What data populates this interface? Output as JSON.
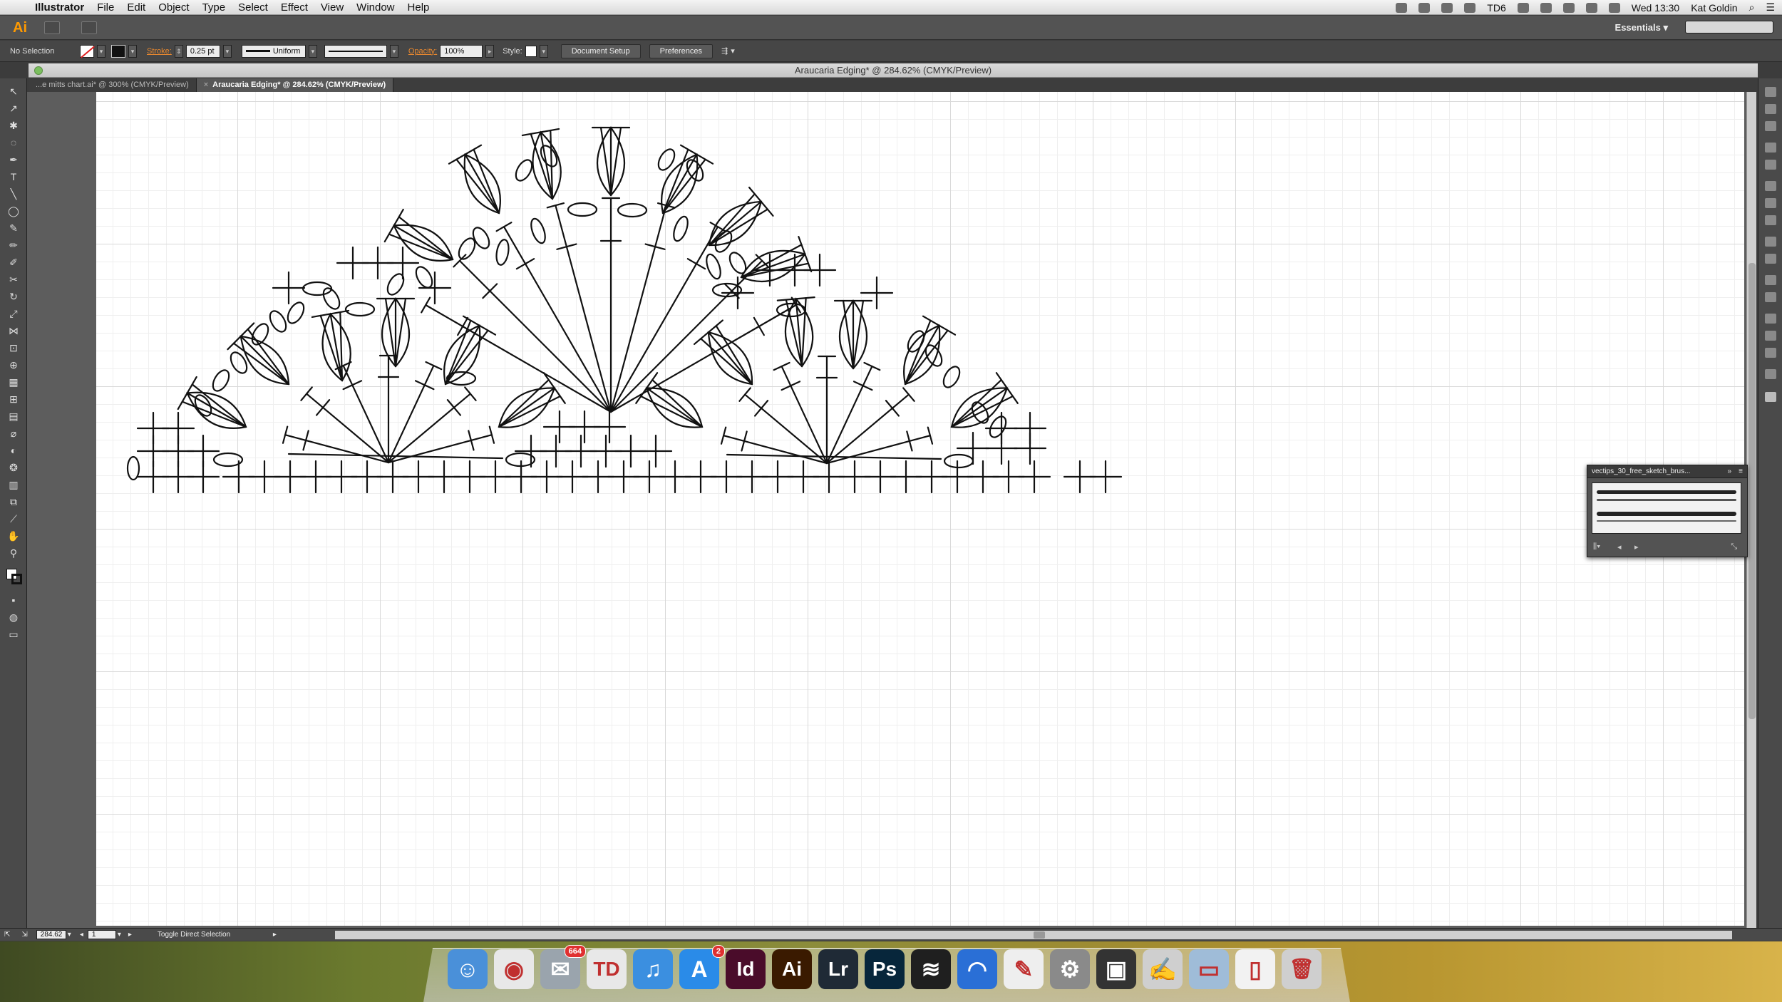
{
  "menubar": {
    "app_name": "Illustrator",
    "items": [
      "File",
      "Edit",
      "Object",
      "Type",
      "Select",
      "Effect",
      "View",
      "Window",
      "Help"
    ],
    "clock": "Wed 13:30",
    "user": "Kat Goldin",
    "td_count": "6"
  },
  "appbar": {
    "logo": "Ai",
    "workspace": "Essentials"
  },
  "controlbar": {
    "selection": "No Selection",
    "stroke_label": "Stroke:",
    "stroke_value": "0.25 pt",
    "profile": "Uniform",
    "opacity_label": "Opacity:",
    "opacity_value": "100%",
    "style_label": "Style:",
    "document_setup": "Document Setup",
    "preferences": "Preferences"
  },
  "document": {
    "title": "Araucaria Edging* @ 284.62% (CMYK/Preview)",
    "tabs": [
      {
        "label": "...e mitts chart.ai* @ 300% (CMYK/Preview)"
      },
      {
        "label": "Araucaria Edging* @ 284.62% (CMYK/Preview)"
      }
    ]
  },
  "brush_panel": {
    "title": "vectips_30_free_sketch_brus..."
  },
  "status": {
    "zoom": "284.62",
    "page": "1",
    "message": "Toggle Direct Selection"
  },
  "dock": {
    "apps": [
      {
        "name": "Finder",
        "color": "#4a90d9",
        "glyph": "☺"
      },
      {
        "name": "Chrome",
        "color": "#e8e8e8",
        "glyph": "◉"
      },
      {
        "name": "Mail",
        "color": "#9aa4ad",
        "glyph": "✉",
        "badge": "664"
      },
      {
        "name": "TweetDeck",
        "color": "#e8e8e8",
        "glyph": "TD"
      },
      {
        "name": "iTunes",
        "color": "#3b8fe0",
        "glyph": "♫"
      },
      {
        "name": "App Store",
        "color": "#2a8be8",
        "glyph": "A",
        "badge": "2"
      },
      {
        "name": "InDesign",
        "color": "#4a0c2a",
        "glyph": "Id"
      },
      {
        "name": "Illustrator",
        "color": "#3a1a00",
        "glyph": "Ai"
      },
      {
        "name": "Lightroom",
        "color": "#1f2a36",
        "glyph": "Lr"
      },
      {
        "name": "Photoshop",
        "color": "#07263b",
        "glyph": "Ps"
      },
      {
        "name": "Spotify",
        "color": "#1f1f1f",
        "glyph": "≋"
      },
      {
        "name": "Skitch",
        "color": "#2a6fd6",
        "glyph": "◠"
      },
      {
        "name": "Acrobat",
        "color": "#eeeeee",
        "glyph": "✎"
      },
      {
        "name": "System Preferences",
        "color": "#8a8a8a",
        "glyph": "⚙"
      },
      {
        "name": "Printer",
        "color": "#333333",
        "glyph": "▣"
      },
      {
        "name": "Script Editor",
        "color": "#cfcfcf",
        "glyph": "✍"
      },
      {
        "name": "Folder",
        "color": "#9fbcd8",
        "glyph": "▭"
      },
      {
        "name": "Document",
        "color": "#f2f2f2",
        "glyph": "▯"
      },
      {
        "name": "Trash",
        "color": "#cfcfcf",
        "glyph": "🗑"
      }
    ]
  },
  "colors": {
    "accent": "#e8882f",
    "workspace_bg": "#535353",
    "artboard": "#ffffff"
  }
}
